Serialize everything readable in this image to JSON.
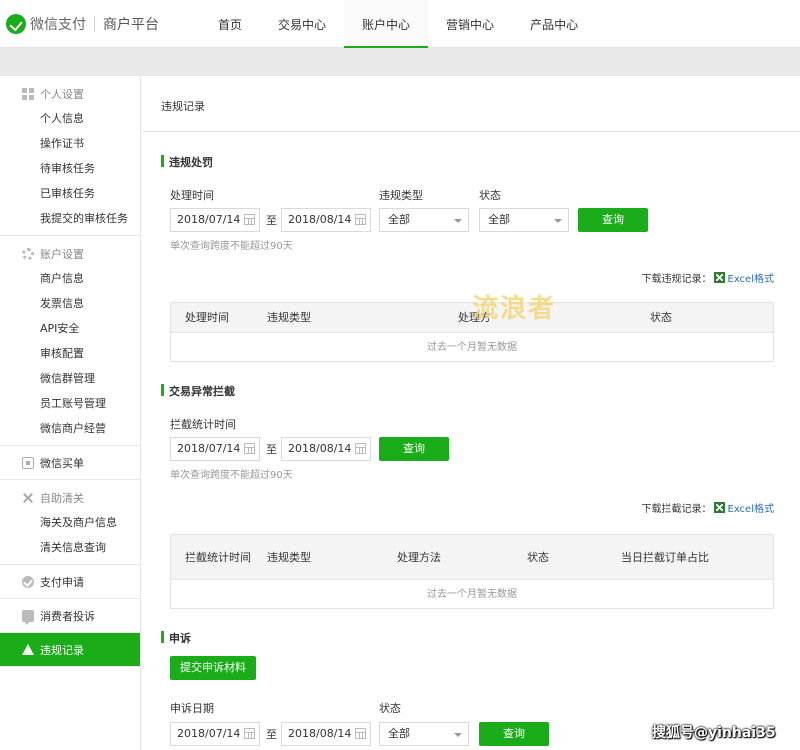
{
  "header": {
    "brand": "微信支付",
    "sub_brand": "商户平台",
    "nav": [
      {
        "label": "首页"
      },
      {
        "label": "交易中心"
      },
      {
        "label": "账户中心",
        "active": true
      },
      {
        "label": "营销中心"
      },
      {
        "label": "产品中心"
      }
    ]
  },
  "sidebar": {
    "groups": [
      {
        "title": "个人设置",
        "icon": "grid-icon",
        "items": [
          "个人信息",
          "操作证书",
          "待审核任务",
          "已审核任务",
          "我提交的审核任务"
        ]
      },
      {
        "title": "账户设置",
        "icon": "gear-icon",
        "items": [
          "商户信息",
          "发票信息",
          "API安全",
          "审核配置",
          "微信群管理",
          "员工账号管理",
          "微信商户经营"
        ]
      }
    ],
    "single_1": {
      "label": "微信买单",
      "icon": "qrcode-icon"
    },
    "customs": {
      "title": "自助清关",
      "icon": "tools-icon",
      "items": [
        "海关及商户信息",
        "清关信息查询"
      ]
    },
    "single_2": {
      "label": "支付申请",
      "icon": "check-circle-icon"
    },
    "single_3": {
      "label": "消费者投诉",
      "icon": "chat-icon"
    },
    "single_4": {
      "label": "违规记录",
      "icon": "warning-icon",
      "active": true
    }
  },
  "main": {
    "page_title": "违规记录",
    "penalty": {
      "section_title": "违规处罚",
      "time_label": "处理时间",
      "start_date": "2018/07/14",
      "to": "至",
      "end_date": "2018/08/14",
      "type_label": "违规类型",
      "type_value": "全部",
      "status_label": "状态",
      "status_value": "全部",
      "query_button": "查询",
      "hint": "单次查询跨度不能超过90天",
      "download_label": "下载违规记录：",
      "download_link": "Excel格式",
      "columns": [
        "处理时间",
        "违规类型",
        "处理方",
        "状态"
      ],
      "empty_text": "过去一个月暂无数据"
    },
    "intercept": {
      "section_title": "交易异常拦截",
      "time_label": "拦截统计时间",
      "start_date": "2018/07/14",
      "to": "至",
      "end_date": "2018/08/14",
      "query_button": "查询",
      "hint": "单次查询跨度不能超过90天",
      "download_label": "下载拦截记录：",
      "download_link": "Excel格式",
      "columns": [
        "拦截统计时间",
        "违规类型",
        "处理方法",
        "状态",
        "当日拦截订单占比"
      ],
      "empty_text": "过去一个月暂无数据"
    },
    "appeal": {
      "section_title": "申诉",
      "submit_button": "提交申诉材料",
      "date_label": "申诉日期",
      "start_date": "2018/07/14",
      "to": "至",
      "end_date": "2018/08/14",
      "status_label": "状态",
      "status_value": "全部",
      "query_button": "查询"
    }
  },
  "watermark": "流浪者",
  "source_mark": "搜狐号@yinhai35",
  "colors": {
    "accent": "#1aad19",
    "link": "#2d6cb5",
    "watermark": "#f3d77a"
  }
}
